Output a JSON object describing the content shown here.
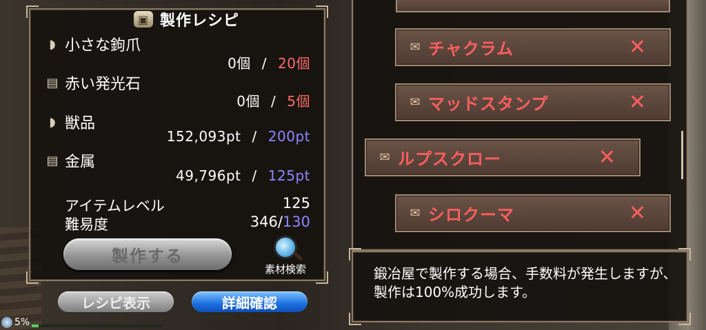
{
  "window": {
    "title": "製作レシピ",
    "title_icon": "chest-icon"
  },
  "materials": [
    {
      "name": "小さな鉤爪",
      "icon": "claw-icon",
      "have": "0個",
      "sep": "/",
      "need": "20個",
      "need_color": "#ff6b6b"
    },
    {
      "name": "赤い発光石",
      "icon": "ore-icon",
      "have": "0個",
      "sep": "/",
      "need": "5個",
      "need_color": "#ff6b6b"
    },
    {
      "name": "獣品",
      "icon": "claw-icon",
      "have": "152,093pt",
      "sep": "/",
      "need": "200pt",
      "need_color": "#8f86ff"
    },
    {
      "name": "金属",
      "icon": "ore-icon",
      "have": "49,796pt",
      "sep": "/",
      "need": "125pt",
      "need_color": "#8f86ff"
    }
  ],
  "stats": {
    "item_level_label": "アイテムレベル",
    "item_level_value": "125",
    "difficulty_label": "難易度",
    "difficulty_value": "346/",
    "difficulty_required": "130"
  },
  "buttons": {
    "craft": "製作する",
    "material_search": "素材検索",
    "show_recipe": "レシピ表示",
    "details": "詳細確認"
  },
  "recipes": [
    {
      "name": "チャクラム",
      "icon": "scroll-icon",
      "remove": "✕"
    },
    {
      "name": "マッドスタンプ",
      "icon": "scroll-icon",
      "remove": "✕"
    },
    {
      "name": "ルプスクロー",
      "icon": "scroll-icon",
      "remove": "✕"
    },
    {
      "name": "シロクーマ",
      "icon": "scroll-icon",
      "remove": "✕"
    }
  ],
  "message": "鍛冶屋で製作する場合、手数料が発生しますが、製作は100%成功します。",
  "status": {
    "percent_label": "5%",
    "progress": 0.05
  },
  "colors": {
    "accent_red": "#ff5f5f",
    "accent_blue": "#8f86ff",
    "detail_button": "#1c6fe0"
  }
}
